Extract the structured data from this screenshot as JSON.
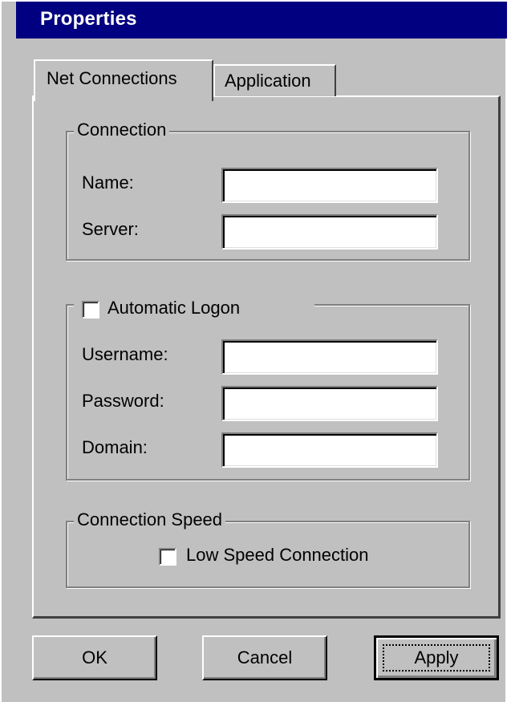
{
  "window": {
    "title": "Properties",
    "colors": {
      "face": "#c0c0c0",
      "titlebar": "#000080",
      "title_text": "#ffffff"
    }
  },
  "tabs": [
    {
      "label": "Net Connections",
      "active": true
    },
    {
      "label": "Application",
      "active": false
    }
  ],
  "connection": {
    "legend": "Connection",
    "name_label": "Name:",
    "name_value": "",
    "server_label": "Server:",
    "server_value": ""
  },
  "logon": {
    "legend": "Automatic Logon",
    "checked": false,
    "username_label": "Username:",
    "username_value": "",
    "password_label": "Password:",
    "password_value": "",
    "domain_label": "Domain:",
    "domain_value": ""
  },
  "speed": {
    "legend": "Connection Speed",
    "low_speed_label": "Low Speed Connection",
    "low_speed_checked": false
  },
  "buttons": {
    "ok": "OK",
    "cancel": "Cancel",
    "apply": "Apply"
  }
}
